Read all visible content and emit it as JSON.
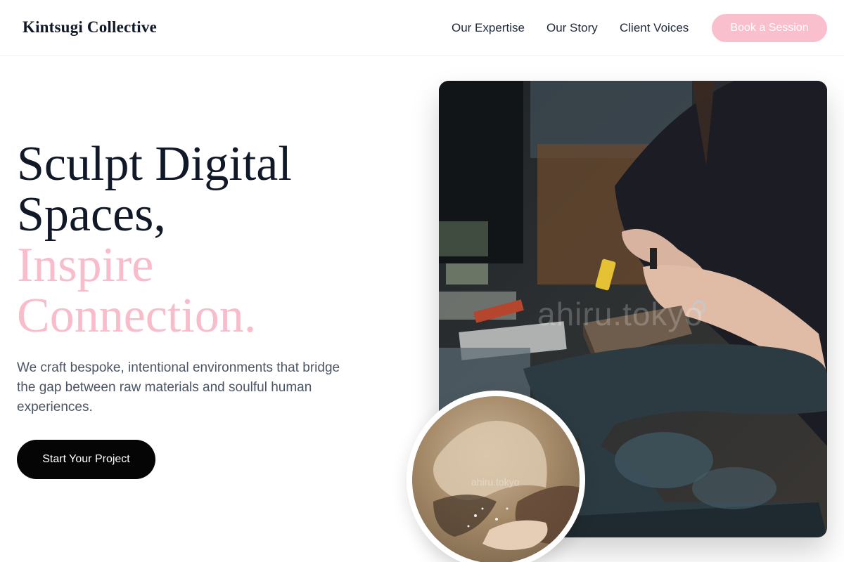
{
  "header": {
    "brand": "Kintsugi Collective",
    "nav": {
      "expertise": "Our Expertise",
      "story": "Our Story",
      "voices": "Client Voices"
    },
    "book_label": "Book a Session"
  },
  "hero": {
    "headline": {
      "line1": "Sculpt Digital",
      "line2": "Spaces,",
      "line3": "Inspire",
      "line4": "Connection."
    },
    "lead": "We craft bespoke, intentional environments that bridge the gap between raw materials and soulful human experiences.",
    "cta_label": "Start Your Project"
  },
  "media": {
    "main_watermark": "ahiru.tokyo",
    "circle_watermark": "ahiru.tokyo"
  },
  "colors": {
    "accent_pink": "#f8bccb",
    "dark": "#111827",
    "cta_background": "#050505"
  }
}
